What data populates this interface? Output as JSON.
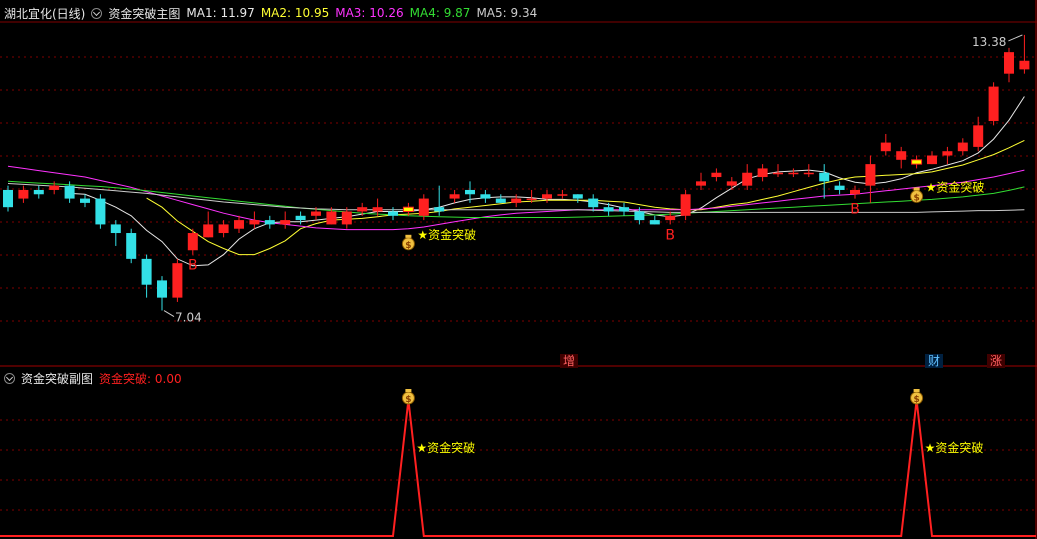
{
  "header": {
    "stock": "湖北宜化(日线)",
    "indicator": "资金突破主图",
    "ma": [
      {
        "label": "MA1: 11.97",
        "color": "#e8e8e8"
      },
      {
        "label": "MA2: 10.95",
        "color": "#ffff33"
      },
      {
        "label": "MA3: 10.26",
        "color": "#ff33ff"
      },
      {
        "label": "MA4: 9.87",
        "color": "#33dd33"
      },
      {
        "label": "MA5: 9.34",
        "color": "#cccccc"
      }
    ]
  },
  "sub_header": {
    "title": "资金突破副图",
    "value_label": "资金突破: 0.00"
  },
  "tags": {
    "zeng": "增",
    "cai": "财",
    "zhang": "涨"
  },
  "colors": {
    "up": "#ff2020",
    "down": "#33e0e6",
    "grid": "#800000",
    "signal": "#ffff00",
    "background": "#000000"
  },
  "chart_data": [
    {
      "type": "candlestick",
      "title": "资金突破主图",
      "ylim": [
        6.2,
        13.7
      ],
      "annotations": {
        "high": "13.38",
        "low": "7.04",
        "signal_text": "★资金突破",
        "buy_marker": "B"
      },
      "candles": [
        [
          9.8,
          9.4,
          9.9,
          9.3
        ],
        [
          9.6,
          9.8,
          9.9,
          9.5
        ],
        [
          9.8,
          9.7,
          9.9,
          9.6
        ],
        [
          9.8,
          9.9,
          10.0,
          9.7
        ],
        [
          9.9,
          9.6,
          10.0,
          9.5
        ],
        [
          9.6,
          9.5,
          9.7,
          9.4
        ],
        [
          9.6,
          9.0,
          9.7,
          8.9
        ],
        [
          9.0,
          8.8,
          9.1,
          8.5
        ],
        [
          8.8,
          8.2,
          8.9,
          8.1
        ],
        [
          8.2,
          7.6,
          8.3,
          7.3
        ],
        [
          7.7,
          7.3,
          7.8,
          7.0
        ],
        [
          7.3,
          8.1,
          8.2,
          7.2
        ],
        [
          8.4,
          8.8,
          8.9,
          8.3
        ],
        [
          8.7,
          9.0,
          9.3,
          8.7
        ],
        [
          8.8,
          9.0,
          9.1,
          8.7
        ],
        [
          8.9,
          9.1,
          9.2,
          8.8
        ],
        [
          9.0,
          9.1,
          9.3,
          8.9
        ],
        [
          9.1,
          9.0,
          9.2,
          8.9
        ],
        [
          9.0,
          9.1,
          9.3,
          8.9
        ],
        [
          9.2,
          9.1,
          9.3,
          9.0
        ],
        [
          9.2,
          9.3,
          9.4,
          9.1
        ],
        [
          9.0,
          9.3,
          9.4,
          9.0
        ],
        [
          9.0,
          9.3,
          9.4,
          8.9
        ],
        [
          9.3,
          9.4,
          9.5,
          9.2
        ],
        [
          9.3,
          9.4,
          9.6,
          9.2
        ],
        [
          9.3,
          9.2,
          9.4,
          9.1
        ],
        [
          9.3,
          9.4,
          9.5,
          9.2
        ],
        [
          9.2,
          9.6,
          9.7,
          9.1
        ],
        [
          9.4,
          9.3,
          9.9,
          9.2
        ],
        [
          9.6,
          9.7,
          9.8,
          9.5
        ],
        [
          9.8,
          9.7,
          10.0,
          9.5
        ],
        [
          9.7,
          9.6,
          9.8,
          9.5
        ],
        [
          9.6,
          9.5,
          9.7,
          9.5
        ],
        [
          9.5,
          9.6,
          9.7,
          9.4
        ],
        [
          9.6,
          9.6,
          9.8,
          9.5
        ],
        [
          9.6,
          9.7,
          9.8,
          9.5
        ],
        [
          9.7,
          9.7,
          9.8,
          9.6
        ],
        [
          9.7,
          9.6,
          9.7,
          9.5
        ],
        [
          9.6,
          9.4,
          9.7,
          9.3
        ],
        [
          9.4,
          9.3,
          9.5,
          9.2
        ],
        [
          9.4,
          9.3,
          9.5,
          9.2
        ],
        [
          9.3,
          9.1,
          9.4,
          9.0
        ],
        [
          9.1,
          9.0,
          9.2,
          9.0
        ],
        [
          9.1,
          9.2,
          9.3,
          9.0
        ],
        [
          9.2,
          9.7,
          9.8,
          9.1
        ],
        [
          9.9,
          10.0,
          10.2,
          9.8
        ],
        [
          10.1,
          10.2,
          10.3,
          10.0
        ],
        [
          9.9,
          10.0,
          10.1,
          9.8
        ],
        [
          9.9,
          10.2,
          10.4,
          9.8
        ],
        [
          10.1,
          10.3,
          10.4,
          10.0
        ],
        [
          10.2,
          10.2,
          10.4,
          10.1
        ],
        [
          10.2,
          10.2,
          10.3,
          10.1
        ],
        [
          10.2,
          10.2,
          10.4,
          10.1
        ],
        [
          10.2,
          10.0,
          10.4,
          9.6
        ],
        [
          9.9,
          9.8,
          10.0,
          9.7
        ],
        [
          9.7,
          9.8,
          9.9,
          9.6
        ],
        [
          9.9,
          10.4,
          10.6,
          9.5
        ],
        [
          10.7,
          10.9,
          11.1,
          10.6
        ],
        [
          10.5,
          10.7,
          10.8,
          10.3
        ],
        [
          10.4,
          10.5,
          10.6,
          10.3
        ],
        [
          10.4,
          10.6,
          10.7,
          10.4
        ],
        [
          10.6,
          10.7,
          10.8,
          10.4
        ],
        [
          10.7,
          10.9,
          11.0,
          10.6
        ],
        [
          10.8,
          11.3,
          11.5,
          10.7
        ],
        [
          11.4,
          12.2,
          12.3,
          11.3
        ],
        [
          12.5,
          13.0,
          13.1,
          12.3
        ],
        [
          12.6,
          12.8,
          13.4,
          12.5
        ]
      ],
      "series": [
        {
          "name": "MA1",
          "color": "#e8e8e8",
          "values": [
            null,
            null,
            null,
            null,
            9.72,
            9.7,
            9.56,
            9.4,
            9.2,
            8.86,
            8.6,
            8.2,
            8.04,
            8.06,
            8.3,
            8.66,
            8.9,
            9.04,
            9.06,
            9.06,
            9.1,
            9.14,
            9.18,
            9.24,
            9.3,
            9.3,
            9.3,
            9.34,
            9.4,
            9.5,
            9.58,
            9.62,
            9.64,
            9.64,
            9.62,
            9.58,
            9.58,
            9.56,
            9.52,
            9.46,
            9.38,
            9.3,
            9.22,
            9.18,
            9.22,
            9.38,
            9.62,
            9.84,
            10.06,
            10.16,
            10.22,
            10.24,
            10.26,
            10.22,
            10.08,
            9.98,
            9.94,
            9.98,
            10.06,
            10.2,
            10.28,
            10.38,
            10.48,
            10.66,
            10.98,
            11.42,
            11.97
          ]
        },
        {
          "name": "MA2",
          "color": "#ffff33",
          "values": [
            null,
            null,
            null,
            null,
            null,
            null,
            null,
            null,
            null,
            9.61,
            9.4,
            9.08,
            8.84,
            8.6,
            8.44,
            8.3,
            8.3,
            8.44,
            8.62,
            8.9,
            9.02,
            9.1,
            9.12,
            9.14,
            9.18,
            9.22,
            9.24,
            9.26,
            9.3,
            9.36,
            9.4,
            9.44,
            9.48,
            9.52,
            9.54,
            9.56,
            9.56,
            9.56,
            9.56,
            9.54,
            9.52,
            9.46,
            9.4,
            9.36,
            9.34,
            9.34,
            9.4,
            9.46,
            9.5,
            9.58,
            9.66,
            9.76,
            9.86,
            9.96,
            10.04,
            10.1,
            10.12,
            10.14,
            10.16,
            10.18,
            10.22,
            10.3,
            10.38,
            10.5,
            10.62,
            10.78,
            10.95
          ]
        },
        {
          "name": "MA3",
          "color": "#ff33ff",
          "values": [
            10.35,
            10.3,
            10.25,
            10.2,
            10.15,
            10.1,
            10.02,
            9.94,
            9.86,
            9.76,
            9.66,
            9.56,
            9.46,
            9.36,
            9.26,
            9.18,
            9.1,
            9.04,
            9.0,
            8.96,
            8.92,
            8.9,
            8.88,
            8.88,
            8.88,
            8.88,
            8.9,
            8.94,
            9.0,
            9.06,
            9.12,
            9.18,
            9.22,
            9.26,
            9.28,
            9.3,
            9.32,
            9.34,
            9.34,
            9.34,
            9.34,
            9.34,
            9.34,
            9.34,
            9.34,
            9.36,
            9.38,
            9.42,
            9.46,
            9.5,
            9.54,
            9.58,
            9.62,
            9.66,
            9.68,
            9.7,
            9.74,
            9.78,
            9.82,
            9.86,
            9.9,
            9.94,
            9.98,
            10.04,
            10.1,
            10.18,
            10.26
          ]
        },
        {
          "name": "MA4",
          "color": "#33dd33",
          "values": [
            10.0,
            9.98,
            9.96,
            9.94,
            9.92,
            9.9,
            9.88,
            9.85,
            9.82,
            9.78,
            9.74,
            9.7,
            9.66,
            9.62,
            9.58,
            9.54,
            9.5,
            9.46,
            9.42,
            9.38,
            9.35,
            9.32,
            9.29,
            9.26,
            9.24,
            9.22,
            9.2,
            9.19,
            9.18,
            9.17,
            9.16,
            9.16,
            9.16,
            9.16,
            9.16,
            9.16,
            9.16,
            9.17,
            9.18,
            9.19,
            9.2,
            9.21,
            9.22,
            9.24,
            9.26,
            9.28,
            9.3,
            9.32,
            9.34,
            9.36,
            9.38,
            9.4,
            9.42,
            9.44,
            9.46,
            9.48,
            9.5,
            9.52,
            9.54,
            9.56,
            9.58,
            9.61,
            9.64,
            9.68,
            9.72,
            9.79,
            9.87
          ]
        },
        {
          "name": "MA5",
          "color": "#cccccc",
          "values": [
            9.95,
            9.93,
            9.91,
            9.89,
            9.87,
            9.84,
            9.81,
            9.78,
            9.75,
            9.72,
            9.68,
            9.64,
            9.6,
            9.56,
            9.52,
            9.49,
            9.46,
            9.43,
            9.4,
            9.38,
            9.36,
            9.35,
            9.34,
            9.34,
            9.34,
            9.34,
            9.34,
            9.34,
            9.34,
            9.34,
            9.34,
            9.34,
            9.34,
            9.34,
            9.34,
            9.34,
            9.34,
            9.34,
            9.33,
            9.32,
            9.31,
            9.3,
            9.29,
            9.28,
            9.28,
            9.28,
            9.28,
            9.28,
            9.28,
            9.28,
            9.28,
            9.28,
            9.28,
            9.28,
            9.28,
            9.28,
            9.28,
            9.28,
            9.28,
            9.28,
            9.29,
            9.3,
            9.31,
            9.32,
            9.32,
            9.33,
            9.34
          ]
        }
      ],
      "buy_signals": [
        12,
        43,
        55
      ],
      "fund_breakthrough": [
        26,
        59
      ],
      "highlight_candles": [
        26,
        59
      ]
    },
    {
      "type": "line",
      "title": "资金突破副图",
      "series": [
        {
          "name": "资金突破",
          "color": "#ff2020",
          "values": [
            0,
            0,
            0,
            0,
            0,
            0,
            0,
            0,
            0,
            0,
            0,
            0,
            0,
            0,
            0,
            0,
            0,
            0,
            0,
            0,
            0,
            0,
            0,
            0,
            0,
            0,
            1,
            0,
            0,
            0,
            0,
            0,
            0,
            0,
            0,
            0,
            0,
            0,
            0,
            0,
            0,
            0,
            0,
            0,
            0,
            0,
            0,
            0,
            0,
            0,
            0,
            0,
            0,
            0,
            0,
            0,
            0,
            0,
            0,
            1,
            0,
            0,
            0,
            0,
            0,
            0,
            0
          ]
        }
      ],
      "ylim": [
        0,
        1
      ]
    }
  ]
}
